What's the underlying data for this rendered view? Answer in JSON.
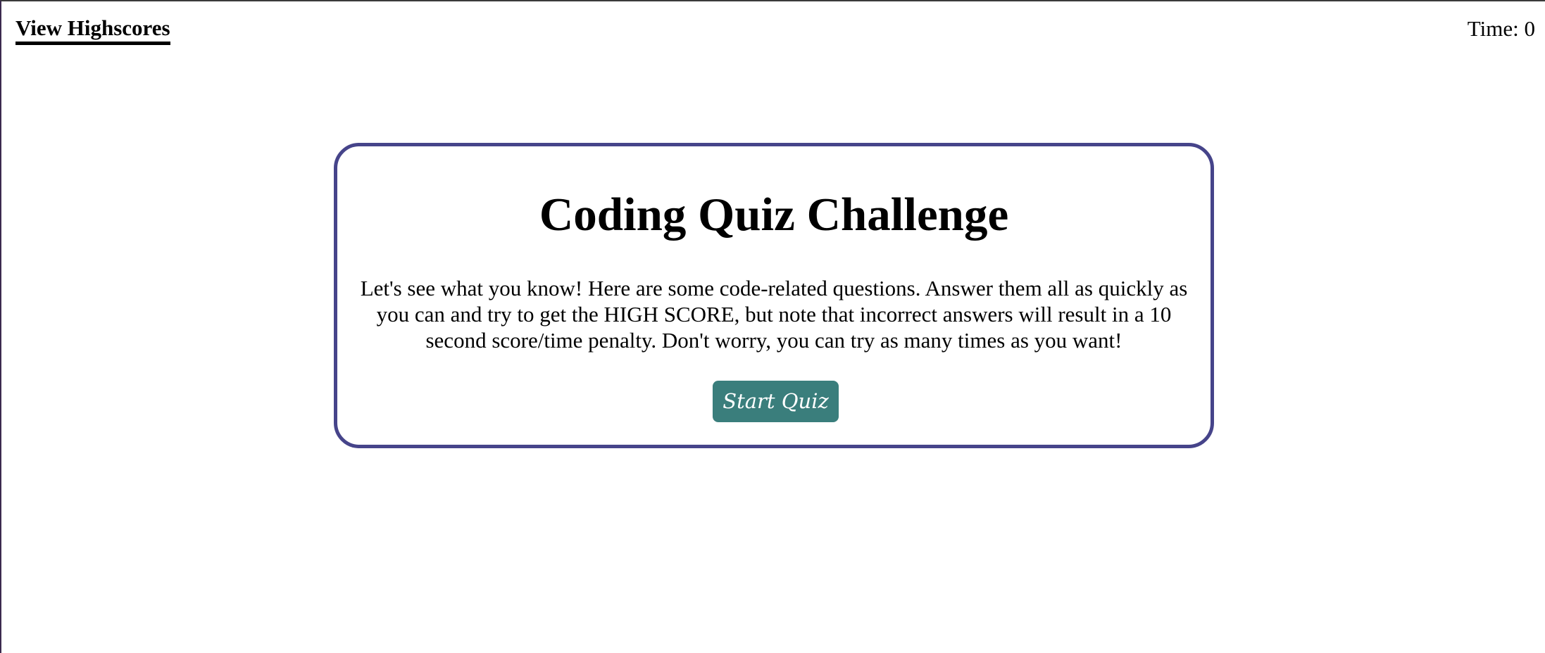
{
  "header": {
    "highscores_link": "View Highscores",
    "timer_text": "Time: 0"
  },
  "card": {
    "title": "Coding Quiz Challenge",
    "description": "Let's see what you know! Here are some code-related questions. Answer them all as quickly as you can and try to get the HIGH SCORE, but note that incorrect answers will result in a 10 second score/time penalty. Don't worry, you can try as many times as you want!",
    "start_button": "Start Quiz"
  },
  "colors": {
    "card_border": "#46448a",
    "button_background": "#3a7e7c",
    "button_text": "#ffffff"
  }
}
